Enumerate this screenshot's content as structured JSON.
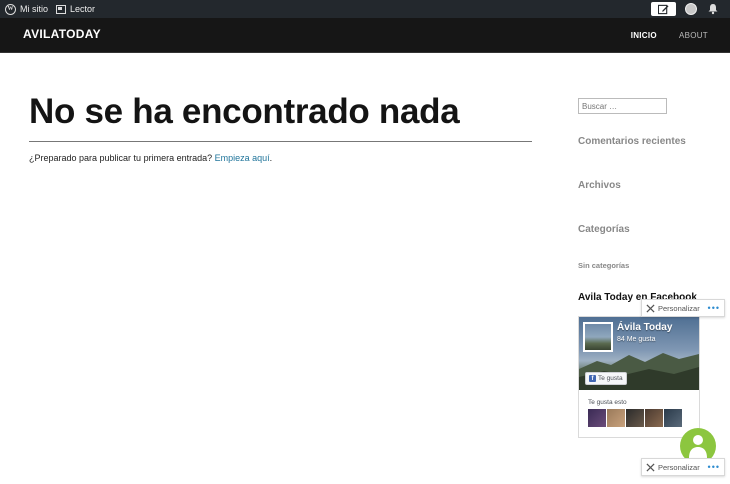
{
  "adminbar": {
    "my_site": "Mi sitio",
    "reader": "Lector"
  },
  "site": {
    "title": "AVILATODAY",
    "nav": [
      {
        "label": "INICIO",
        "active": true
      },
      {
        "label": "ABOUT",
        "active": false
      }
    ]
  },
  "main": {
    "title": "No se ha encontrado nada",
    "lead_text": "¿Preparado para publicar tu primera entrada? ",
    "lead_link": "Empieza aquí",
    "lead_end": "."
  },
  "sidebar": {
    "search_placeholder": "Buscar …",
    "recent_comments": "Comentarios recientes",
    "archives": "Archivos",
    "categories": "Categorías",
    "uncategorized": "Sin categorías",
    "facebook_title": "Avila Today en Facebook"
  },
  "facebook_widget": {
    "page_name": "Ávila Today",
    "likes": "84 Me gusta",
    "like_button": "Te gusta",
    "friends_label": "Te gusta esto"
  },
  "customize": {
    "label": "Personalizar",
    "more": "•••"
  },
  "colors": {
    "adminbar_bg": "#23282d",
    "header_bg": "#161616",
    "link": "#21759b",
    "facebook_blue": "#4267b2"
  }
}
